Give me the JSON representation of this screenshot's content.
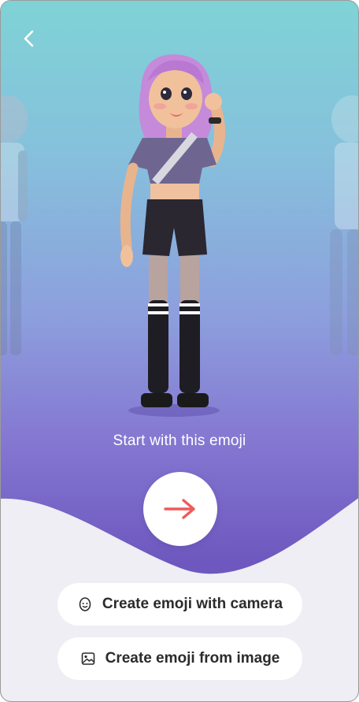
{
  "header": {
    "back_icon": "chevron-left-icon"
  },
  "hero": {
    "caption": "Start with this emoji"
  },
  "actions": {
    "next_icon": "arrow-right-icon",
    "next_color": "#ef5a5a",
    "camera_label": "Create emoji with camera",
    "camera_icon": "face-icon",
    "image_label": "Create emoji from image",
    "image_icon": "image-icon"
  }
}
